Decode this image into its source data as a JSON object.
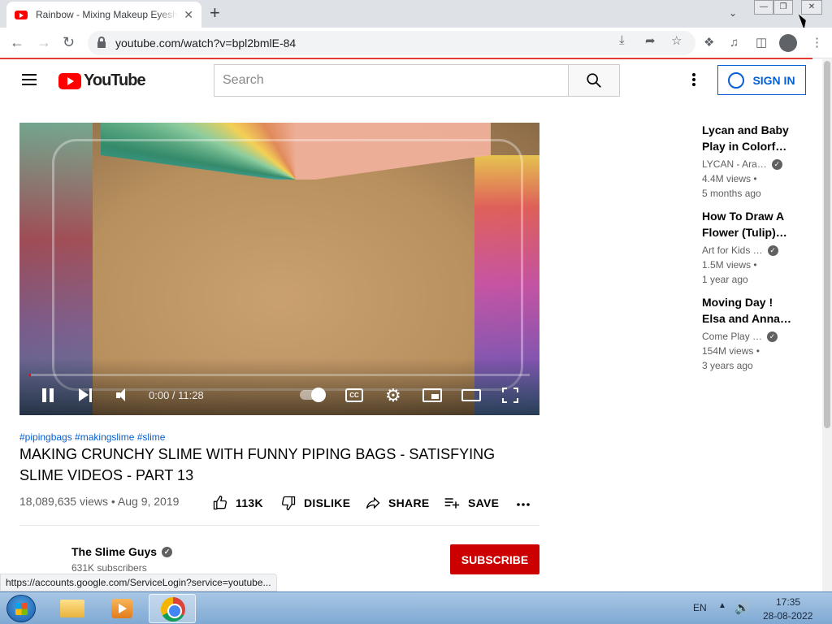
{
  "browser": {
    "tab_title": "Rainbow - Mixing Makeup Eyeshadow",
    "tab_close": "✕",
    "new_tab": "+",
    "url": "youtube.com/watch?v=bpl2bmlE-84",
    "status_url": "https://accounts.google.com/ServiceLogin?service=youtube..."
  },
  "youtube": {
    "logo_text": "YouTube",
    "search_placeholder": "Search",
    "signin_label": "SIGN IN"
  },
  "player": {
    "time": "0:00 / 11:28",
    "progress_fraction": 0.0,
    "cc_label": "CC"
  },
  "video": {
    "hashtags": "#pipingbags #makingslime #slime",
    "title": "MAKING CRUNCHY SLIME WITH FUNNY PIPING BAGS - SATISFYING SLIME VIDEOS - PART 13",
    "views": "18,089,635 views",
    "date": "Aug 9, 2019",
    "meta_sep": " • ",
    "likes": "113K",
    "dislike_label": "DISLIKE",
    "share_label": "SHARE",
    "save_label": "SAVE"
  },
  "channel": {
    "name": "The Slime Guys",
    "subscribers": "631K subscribers",
    "subscribe_label": "SUBSCRIBE"
  },
  "related": [
    {
      "title": "Lycan and Baby Play in Colorf…",
      "channel": "LYCAN - Ara…",
      "views": "4.4M views •",
      "age": "5 months ago"
    },
    {
      "title": "How To Draw A Flower (Tulip)…",
      "channel": "Art for Kids …",
      "views": "1.5M views •",
      "age": "1 year ago"
    },
    {
      "title": "Moving Day ! Elsa and Anna…",
      "channel": "Come Play …",
      "views": "154M views •",
      "age": "3 years ago"
    }
  ],
  "taskbar": {
    "lang": "EN",
    "time": "17:35",
    "date": "28-08-2022"
  },
  "colors": {
    "yt_red": "#ff0000",
    "subscribe_red": "#cc0000",
    "link_blue": "#065fd4"
  },
  "icons": [
    "youtube-favicon-icon",
    "back-icon",
    "forward-icon",
    "reload-icon",
    "lock-icon",
    "download-icon",
    "share-icon",
    "star-icon",
    "extensions-icon",
    "media-icon",
    "sidepanel-icon",
    "profile-icon",
    "menu-icon",
    "search-icon",
    "account-icon",
    "pause-icon",
    "next-icon",
    "volume-icon",
    "settings-icon",
    "miniplayer-icon",
    "theater-icon",
    "fullscreen-icon",
    "like-icon",
    "dislike-icon",
    "share-arrow-icon",
    "playlist-add-icon",
    "verified-icon",
    "windows-start-icon",
    "explorer-icon",
    "media-player-icon",
    "chrome-icon",
    "speaker-icon"
  ]
}
